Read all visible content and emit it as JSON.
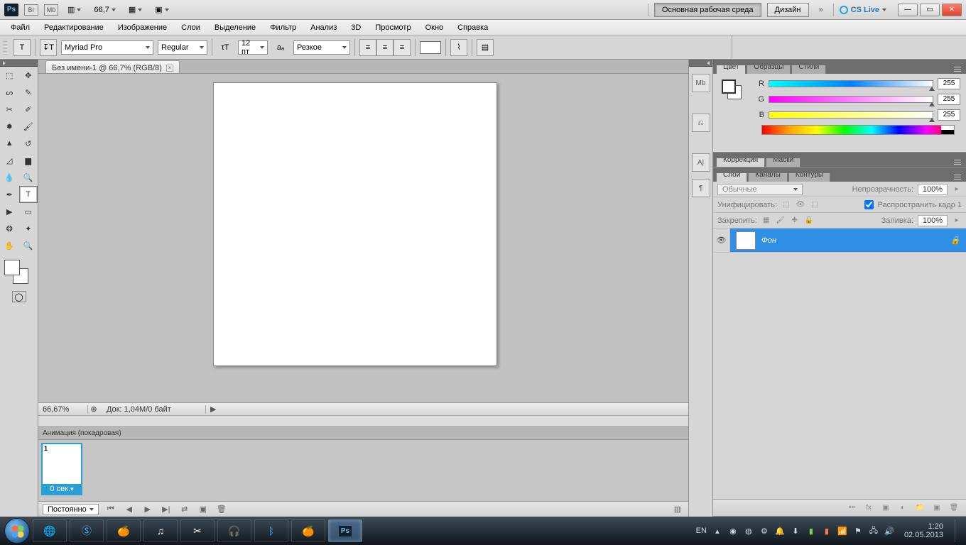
{
  "titlebar": {
    "zoom": "66,7",
    "workspace_main": "Основная рабочая среда",
    "workspace_design": "Дизайн",
    "cslive": "CS Live"
  },
  "menu": [
    "Файл",
    "Редактирование",
    "Изображение",
    "Слои",
    "Выделение",
    "Фильтр",
    "Анализ",
    "3D",
    "Просмотр",
    "Окно",
    "Справка"
  ],
  "options": {
    "font_family": "Myriad Pro",
    "font_style": "Regular",
    "font_size": "12 пт",
    "aa": "Резкое"
  },
  "document": {
    "tab_title": "Без имени-1 @ 66,7% (RGB/8)",
    "status_zoom": "66,67%",
    "status_info": "Док: 1,04M/0 байт"
  },
  "animation": {
    "header": "Анимация (покадровая)",
    "frame_num": "1",
    "frame_dur": "0 сек.",
    "loop": "Постоянно"
  },
  "panels": {
    "color_tabs": [
      "Цвет",
      "Образцы",
      "Стили"
    ],
    "rgb": {
      "r_label": "R",
      "g_label": "G",
      "b_label": "B",
      "r": "255",
      "g": "255",
      "b": "255"
    },
    "adjust_tabs": [
      "Коррекция",
      "Маски"
    ],
    "layers_tabs": [
      "Слои",
      "Каналы",
      "Контуры"
    ],
    "blend_mode": "Обычные",
    "opacity_label": "Непрозрачность:",
    "opacity": "100%",
    "unify_label": "Унифицировать:",
    "propagate_label": "Распространить кадр 1",
    "lock_label": "Закрепить:",
    "fill_label": "Заливка:",
    "fill": "100%",
    "layer_name": "Фон"
  },
  "taskbar": {
    "lang": "EN",
    "time": "1:20",
    "date": "02.05.2013"
  }
}
